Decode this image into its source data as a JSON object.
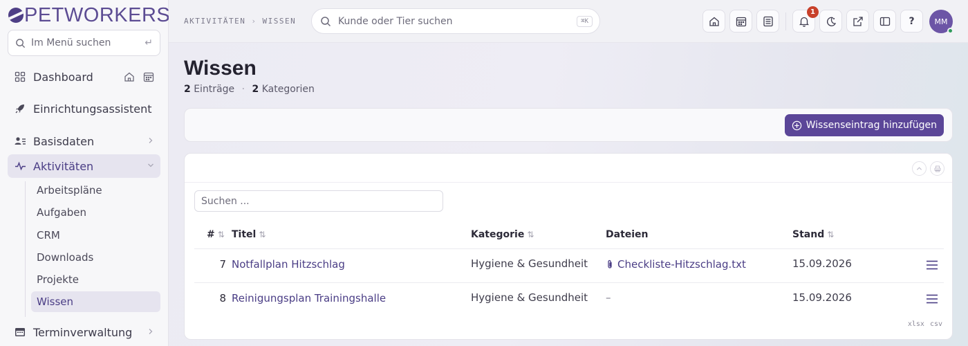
{
  "brand": {
    "name": "PETWORKERS"
  },
  "sidebar": {
    "search_placeholder": "Im Menü suchen",
    "items": [
      {
        "label": "Dashboard"
      },
      {
        "label": "Einrichtungsassistent"
      },
      {
        "label": "Basisdaten"
      },
      {
        "label": "Aktivitäten"
      },
      {
        "label": "Terminverwaltung"
      }
    ],
    "sub_items": [
      {
        "label": "Arbeitspläne"
      },
      {
        "label": "Aufgaben"
      },
      {
        "label": "CRM"
      },
      {
        "label": "Downloads"
      },
      {
        "label": "Projekte"
      },
      {
        "label": "Wissen"
      }
    ]
  },
  "header": {
    "breadcrumb": [
      "AKTIVITÄTEN",
      "WISSEN"
    ],
    "search_placeholder": "Kunde oder Tier suchen",
    "search_shortcut": "⌘K",
    "notification_count": "1",
    "avatar_initials": "MM"
  },
  "page": {
    "title": "Wissen",
    "entries_count": "2",
    "entries_label": "Einträge",
    "categories_count": "2",
    "categories_label": "Kategorien",
    "add_button": "Wissenseintrag hinzufügen"
  },
  "table": {
    "search_placeholder": "Suchen ...",
    "columns": [
      "#",
      "Titel",
      "Kategorie",
      "Dateien",
      "Stand"
    ],
    "rows": [
      {
        "id": "7",
        "title": "Notfallplan Hitzschlag",
        "category": "Hygiene & Gesundheit",
        "file": "Checkliste-Hitzschlag.txt",
        "date": "15.09.2026"
      },
      {
        "id": "8",
        "title": "Reinigungsplan Trainingshalle",
        "category": "Hygiene & Gesundheit",
        "file": "–",
        "date": "15.09.2026"
      }
    ],
    "export": [
      "xlsx",
      "csv"
    ]
  },
  "colors": {
    "accent": "#5b4698",
    "badge": "#c8402a",
    "online": "#2e9a5b"
  }
}
